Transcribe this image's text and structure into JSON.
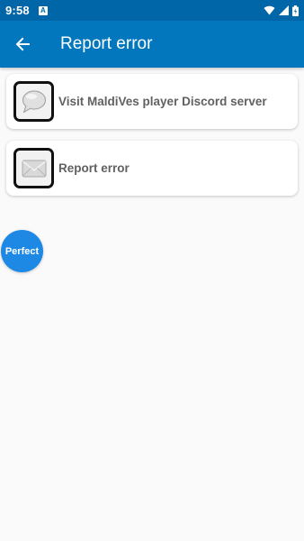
{
  "status_bar": {
    "time": "9:58",
    "notification_badge": "A"
  },
  "app_bar": {
    "title": "Report error",
    "back_icon": "arrow-back-icon"
  },
  "items": [
    {
      "label": "Visit MaldiVes player Discord server",
      "icon": "chat-bubble-icon"
    },
    {
      "label": "Report error",
      "icon": "envelope-icon"
    }
  ],
  "floating_button": {
    "label": "Perfect"
  },
  "colors": {
    "status_bar": "#0066a8",
    "app_bar": "#0277bd",
    "floating_button": "#1e88e5",
    "background": "#fafafa"
  }
}
